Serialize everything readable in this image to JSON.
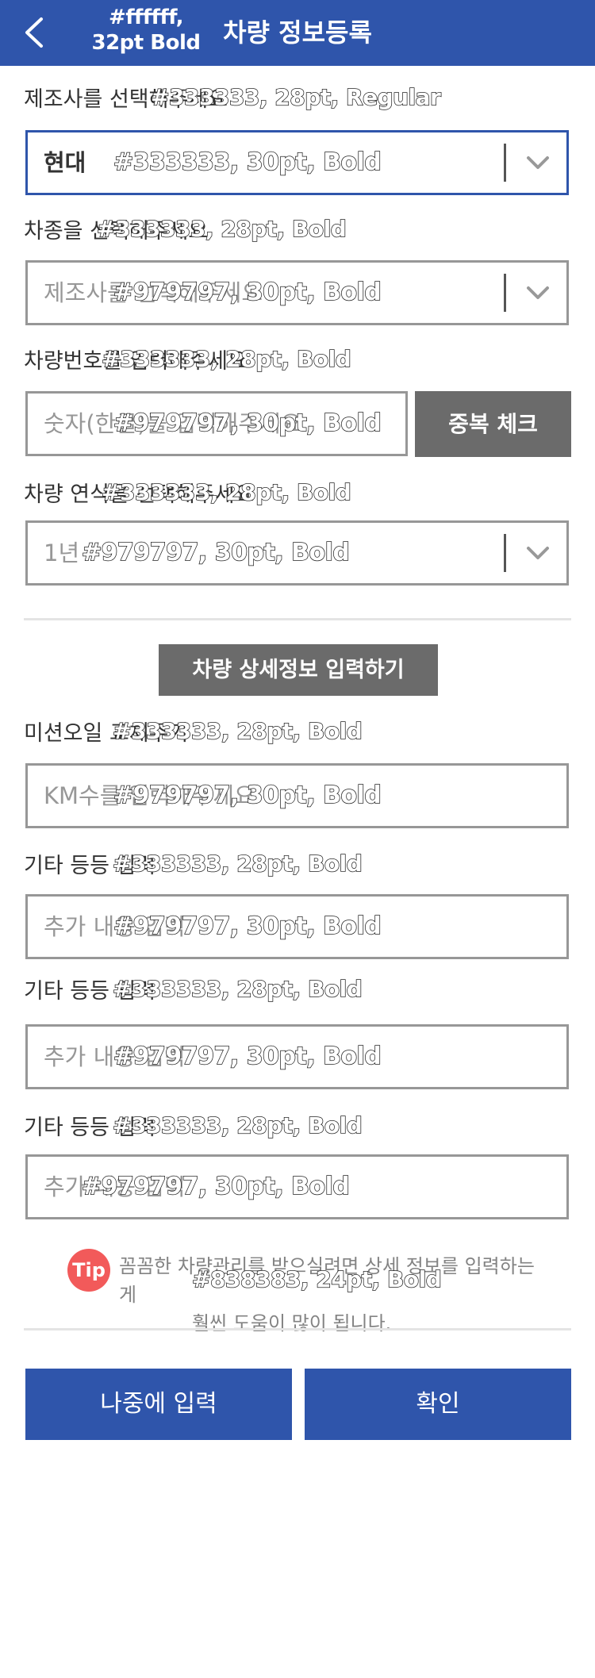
{
  "header": {
    "title": "차량 정보등록",
    "spec": "#ffffff, 32pt Bold"
  },
  "sections": {
    "manufacturer": {
      "label": "제조사를 선택해주세요",
      "label_spec": "#333333, 28pt,  Regular",
      "value": "현대",
      "value_spec": "#333333, 30pt, Bold"
    },
    "model": {
      "label": "차종을 선택해주세요",
      "label_spec": "#333333, 28pt, Bold",
      "placeholder": "제조사를 선택해주세요",
      "placeholder_spec": "#979797, 30pt, Bold"
    },
    "plate": {
      "label": "차량번호를 입력해주세요",
      "label_spec": "#333333, 28pt, Bold",
      "placeholder": "숫자(한글)를 입력해주세요",
      "placeholder_spec": "#979797, 30pt, Bold",
      "button": "중복 체크"
    },
    "year": {
      "label": "차량 연식을 선택해주세요",
      "label_spec": "#333333, 28pt, Bold",
      "value": "1년",
      "value_spec": "#979797, 30pt, Bold"
    },
    "detail_button": "차량 상세정보 입력하기",
    "oil": {
      "label": "미션오일 교체주기",
      "label_spec": "#333333, 28pt, Bold",
      "placeholder": "KM수를 입력해주세요",
      "placeholder_spec": "#979797, 30pt, Bold"
    },
    "extra1": {
      "label": "기타 등등 입력",
      "label_spec": "#333333, 28pt, Bold",
      "placeholder": "추가 내용 입력",
      "placeholder_spec": "#979797, 30pt, Bold"
    },
    "extra2": {
      "label": "기타 등등 입력",
      "label_spec": "#333333, 28pt, Bold",
      "placeholder": "추가 내용 입력",
      "placeholder_spec": "#979797, 30pt, Bold"
    },
    "extra3": {
      "label": "기타 등등 입력",
      "label_spec": "#333333, 28pt, Bold",
      "placeholder": "추가 내용 입력",
      "placeholder_spec": "#979797, 30pt, Bold"
    }
  },
  "tip": {
    "badge": "Tip",
    "line1": "꼼꼼한 차량관리를 받으실려면 상세 정보를 입력하는게",
    "line2": "훨씬 도움이 많이 됩니다.",
    "spec": "#838383, 24pt, Bold"
  },
  "actions": {
    "later": "나중에 입력",
    "confirm": "확인"
  },
  "colors": {
    "primary": "#2f55ab",
    "gray_button": "#6b6b6b",
    "border": "#979797",
    "tip": "#f25a5a"
  }
}
